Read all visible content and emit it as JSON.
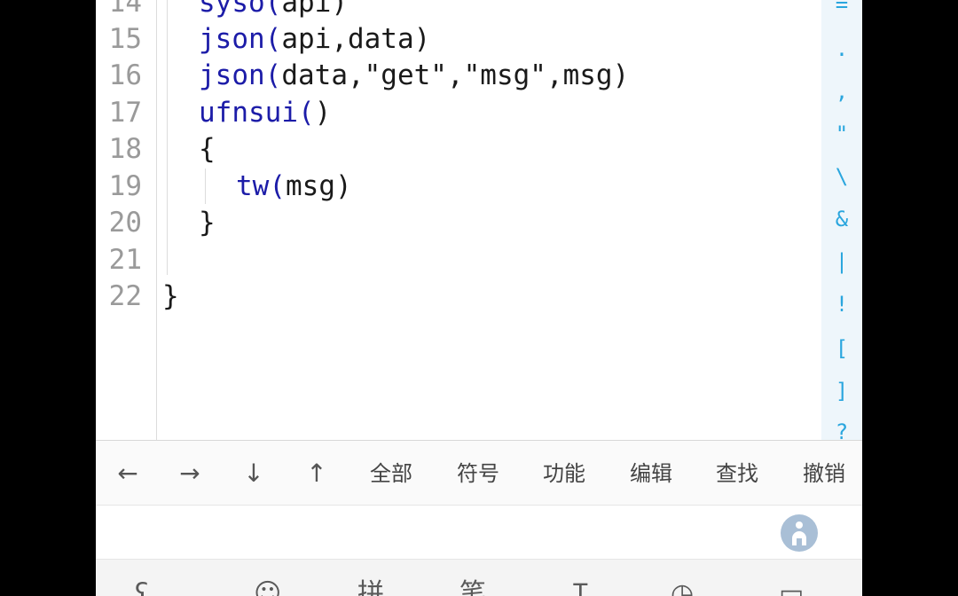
{
  "editor": {
    "line_numbers": [
      "14",
      "15",
      "16",
      "17",
      "18",
      "19",
      "20",
      "21",
      "22"
    ],
    "lines": [
      {
        "kw": "syso(",
        "rest": "api)"
      },
      {
        "kw": "json(",
        "rest": "api,data)"
      },
      {
        "kw": "json(",
        "rest": "data,\"get\",\"msg\",msg)"
      },
      {
        "kw": "ufnsui(",
        "rest": ")"
      },
      {
        "kw": "",
        "rest": "{"
      },
      {
        "kw": "tw(",
        "rest": "msg)"
      },
      {
        "kw": "",
        "rest": "}"
      },
      {
        "kw": "",
        "rest": ""
      },
      {
        "kw": "",
        "rest": "}"
      }
    ],
    "symbol_bar": [
      "=",
      ".",
      ",",
      "\"",
      "\\",
      "&",
      "|",
      "!",
      "[",
      "]",
      "?"
    ]
  },
  "toolbar": {
    "left": "←",
    "right": "→",
    "down": "↓",
    "up": "↑",
    "all": "全部",
    "symbols": "符号",
    "functions": "功能",
    "edit": "编辑",
    "find": "查找",
    "undo": "撤销"
  },
  "ime": {
    "logo_icon": "ime-logo-icon"
  },
  "keyboard_row": {
    "icons": [
      "bear-icon",
      "emoji-icon",
      "pinyin-icon",
      "stroke-icon",
      "text-cursor-icon",
      "clipboard-icon",
      "keyboard-icon"
    ],
    "glyphs": [
      "ʕ",
      "☺",
      "拼",
      "笔",
      "Ɪ",
      "◷",
      "▭"
    ]
  },
  "colors": {
    "keyword": "#1c1ca8",
    "symbol": "#2aa6de",
    "line_number": "#9a9a9a",
    "background_frame": "#000000"
  }
}
